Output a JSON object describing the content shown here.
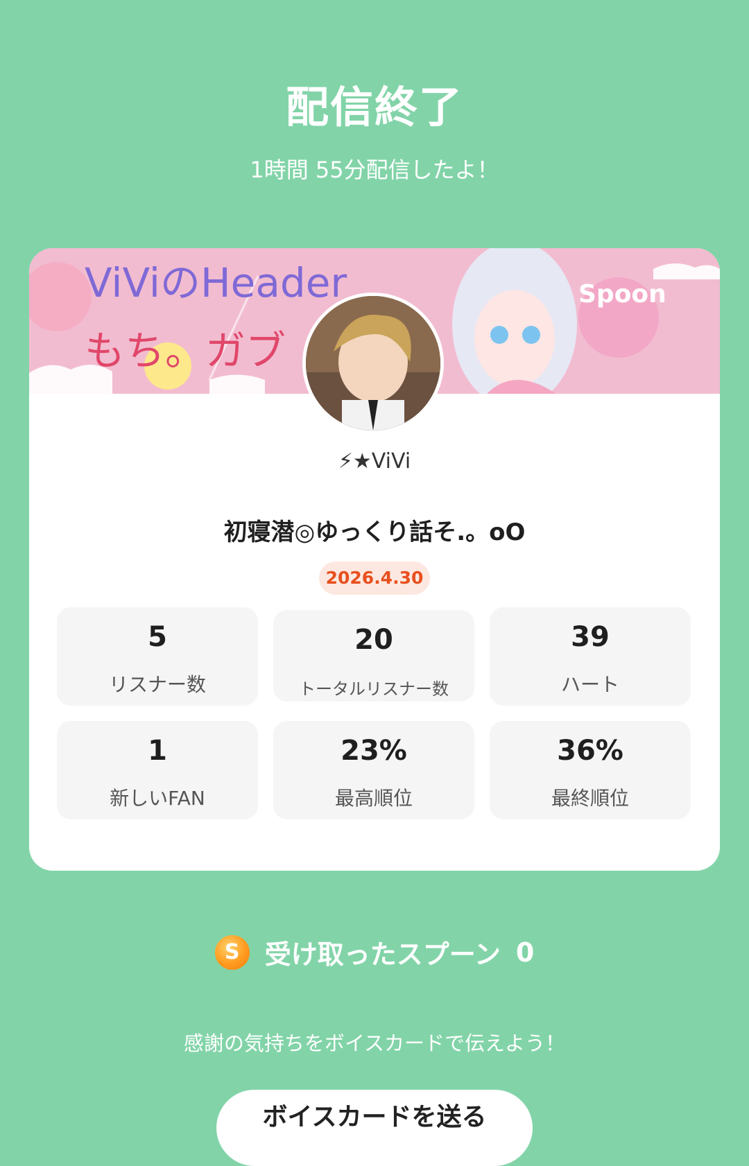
{
  "header": {
    "title": "配信終了",
    "subtitle": "1時間 55分配信したよ！"
  },
  "card": {
    "banner_text_line1": "ViViのHeader",
    "banner_text_line2": "もち。ガブ",
    "banner_brand": "Spoon",
    "username": "⚡★ViVi",
    "stream_title": "初寝潜◎ゆっくり話そ.。oO",
    "date": "2026.4.30",
    "stats": [
      {
        "value": "5",
        "label": "リスナー数"
      },
      {
        "value": "20",
        "label": "トータルリスナー数"
      },
      {
        "value": "39",
        "label": "ハート"
      },
      {
        "value": "1",
        "label": "新しいFAN"
      },
      {
        "value": "23%",
        "label": "最高順位"
      },
      {
        "value": "36%",
        "label": "最終順位"
      }
    ]
  },
  "spoons": {
    "icon": "spoon-coin-icon",
    "coin_letter": "S",
    "label": "受け取ったスプーン",
    "count": "0"
  },
  "thanks_text": "感謝の気持ちをボイスカードで伝えよう！",
  "voice_card_button": "ボイスカードを送る",
  "colors": {
    "background": "#82d4a8",
    "accent": "#e8501e",
    "coin": "#ff9a1e"
  }
}
